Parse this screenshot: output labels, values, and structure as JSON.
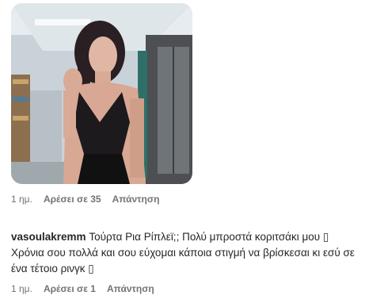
{
  "reply1": {
    "time": "1 ημ.",
    "likes_label": "Αρέσει σε 35",
    "reply_label": "Απάντηση"
  },
  "comment": {
    "username": "vasoulakremm",
    "text": "Τούρτα Ρια Ρίπλεϊ;; Πολύ μπροστά κοριτσάκι μου ▯ Χρόνια σου πολλά και σου εύχομαι κάποια στιγμή να βρίσκεσαι κι εσύ σε ένα τέτοιο ρινγκ ▯",
    "time": "1 ημ.",
    "likes_label": "Αρέσει σε 1",
    "reply_label": "Απάντηση"
  }
}
